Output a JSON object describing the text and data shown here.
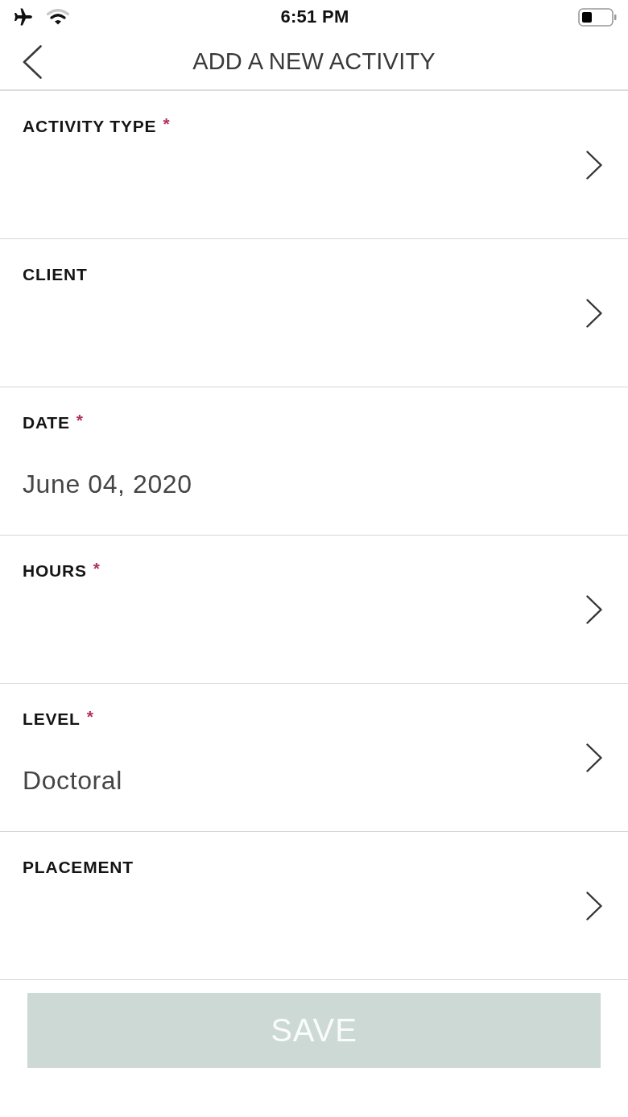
{
  "status_bar": {
    "time": "6:51 PM"
  },
  "header": {
    "title": "ADD A NEW ACTIVITY"
  },
  "fields": [
    {
      "kind": "select",
      "label": "ACTIVITY TYPE",
      "required_mark": "*"
    },
    {
      "kind": "select",
      "label": "CLIENT"
    },
    {
      "kind": "date",
      "label": "DATE",
      "required_mark": "*",
      "value": "June 04, 2020"
    },
    {
      "kind": "select",
      "label": "HOURS",
      "required_mark": "*"
    },
    {
      "kind": "select",
      "label": "LEVEL",
      "required_mark": "*",
      "value": "Doctoral"
    },
    {
      "kind": "select",
      "label": "PLACEMENT"
    }
  ],
  "save_button": {
    "label": "SAVE",
    "disabled": true
  }
}
